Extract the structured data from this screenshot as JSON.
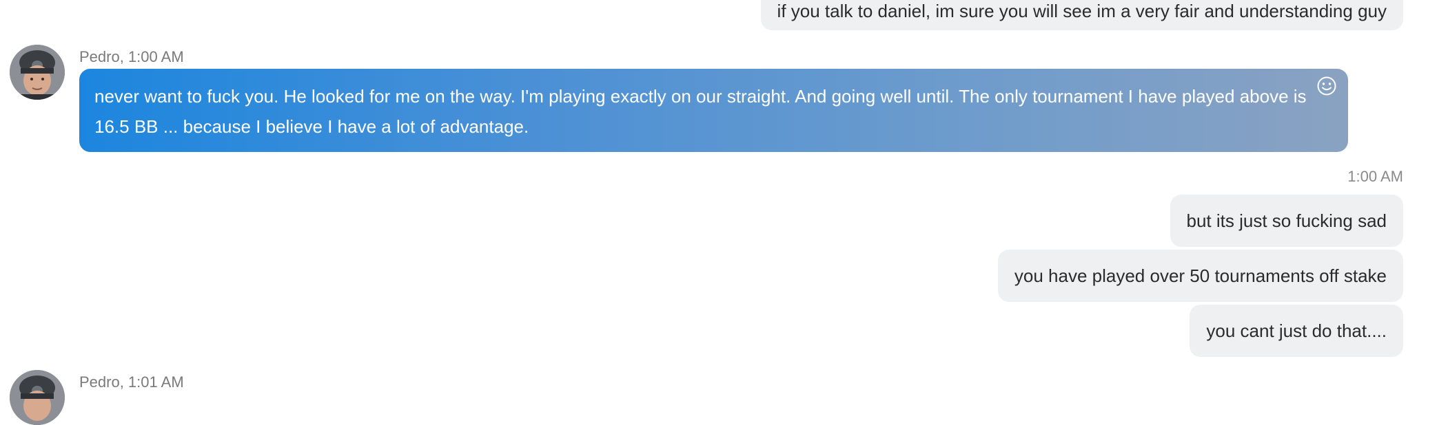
{
  "messages": {
    "top_out": "if you talk to daniel,  im sure you will see im a very fair and understanding guy",
    "pedro_1": {
      "meta": "Pedro, 1:00 AM",
      "text": " never want to fuck you. He looked for me on the way. I'm playing exactly on our straight. And going well until. The only tournament I have played above is 16.5 BB ... because I believe I have a lot of advantage."
    },
    "out_time": "1:00 AM",
    "out_1": "but its just so fucking sad",
    "out_2": "you have played over 50 tournaments off stake",
    "out_3": "you cant just do that....",
    "pedro_2": {
      "meta": "Pedro, 1:01 AM"
    }
  },
  "icons": {
    "reaction": "smiley-icon",
    "avatar": "user-avatar"
  },
  "colors": {
    "incoming_gradient_start": "#1c86de",
    "incoming_gradient_end": "#8aa2c2",
    "outgoing_bg": "#eef0f2",
    "meta_text": "#7a7a7a"
  }
}
